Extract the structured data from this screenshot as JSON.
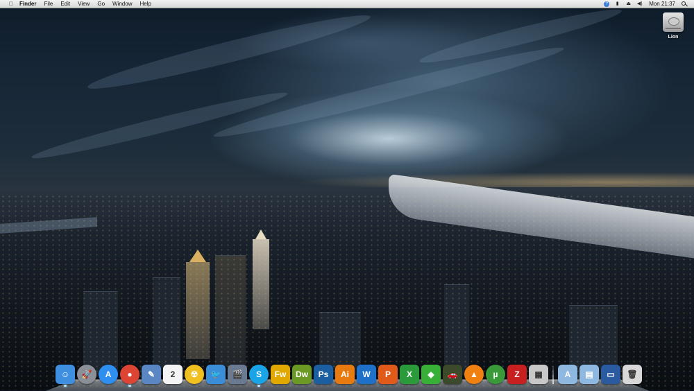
{
  "menubar": {
    "apple": "",
    "items": [
      "Finder",
      "File",
      "Edit",
      "View",
      "Go",
      "Window",
      "Help"
    ],
    "status_icons": [
      "help-icon",
      "battery-icon",
      "eject-icon",
      "volume-icon"
    ],
    "clock": "Mon 21:37"
  },
  "desktop": {
    "drive_label": "Lion"
  },
  "dock": {
    "apps": [
      {
        "name": "finder-icon",
        "glyph": "☺",
        "bg": "#3f8fe0",
        "running": true
      },
      {
        "name": "launchpad-icon",
        "glyph": "🚀",
        "bg": "#8a8f98",
        "round": true
      },
      {
        "name": "app-store-icon",
        "glyph": "A",
        "bg": "#2e8ff0",
        "round": true
      },
      {
        "name": "chrome-icon",
        "glyph": "●",
        "bg": "#dd4433",
        "round": true,
        "running": true
      },
      {
        "name": "preview-icon",
        "glyph": "✎",
        "bg": "#5b86c4"
      },
      {
        "name": "calendar-icon",
        "glyph": "2",
        "bg": "#f4f4f4"
      },
      {
        "name": "radiation-app-icon",
        "glyph": "☢",
        "bg": "#f0c020",
        "round": true
      },
      {
        "name": "twitter-icon",
        "glyph": "🐦",
        "bg": "#3a8ed8"
      },
      {
        "name": "imovie-icon",
        "glyph": "🎬",
        "bg": "#6a7a90"
      },
      {
        "name": "skype-icon",
        "glyph": "S",
        "bg": "#19a4e8",
        "round": true,
        "running": true
      },
      {
        "name": "fireworks-icon",
        "glyph": "Fw",
        "bg": "#e0a800"
      },
      {
        "name": "dreamweaver-icon",
        "glyph": "Dw",
        "bg": "#6a9a24"
      },
      {
        "name": "photoshop-icon",
        "glyph": "Ps",
        "bg": "#1c5fa0"
      },
      {
        "name": "illustrator-icon",
        "glyph": "Ai",
        "bg": "#e87a10"
      },
      {
        "name": "word-icon",
        "glyph": "W",
        "bg": "#1e70c8"
      },
      {
        "name": "powerpoint-icon",
        "glyph": "P",
        "bg": "#e05a1a"
      },
      {
        "name": "excel-icon",
        "glyph": "X",
        "bg": "#2a9a3a"
      },
      {
        "name": "sims-icon",
        "glyph": "◆",
        "bg": "#38b038"
      },
      {
        "name": "car-app-icon",
        "glyph": "🚗",
        "bg": "#3a4a2a"
      },
      {
        "name": "vlc-icon",
        "glyph": "▲",
        "bg": "#f08010",
        "round": true
      },
      {
        "name": "utorrent-icon",
        "glyph": "µ",
        "bg": "#3a9a3a",
        "round": true
      },
      {
        "name": "filezilla-icon",
        "glyph": "Z",
        "bg": "#c82020"
      },
      {
        "name": "calculator-icon",
        "glyph": "▦",
        "bg": "#c8c8c8"
      }
    ],
    "stacks": [
      {
        "name": "applications-folder-icon",
        "glyph": "A",
        "bg": "#8fb8e0"
      },
      {
        "name": "documents-folder-icon",
        "glyph": "▤",
        "bg": "#8fb8e0"
      },
      {
        "name": "downloads-stack-icon",
        "glyph": "▭",
        "bg": "#2a5aa0"
      },
      {
        "name": "trash-icon",
        "glyph": "🗑",
        "bg": "#d8d8d8"
      }
    ]
  }
}
